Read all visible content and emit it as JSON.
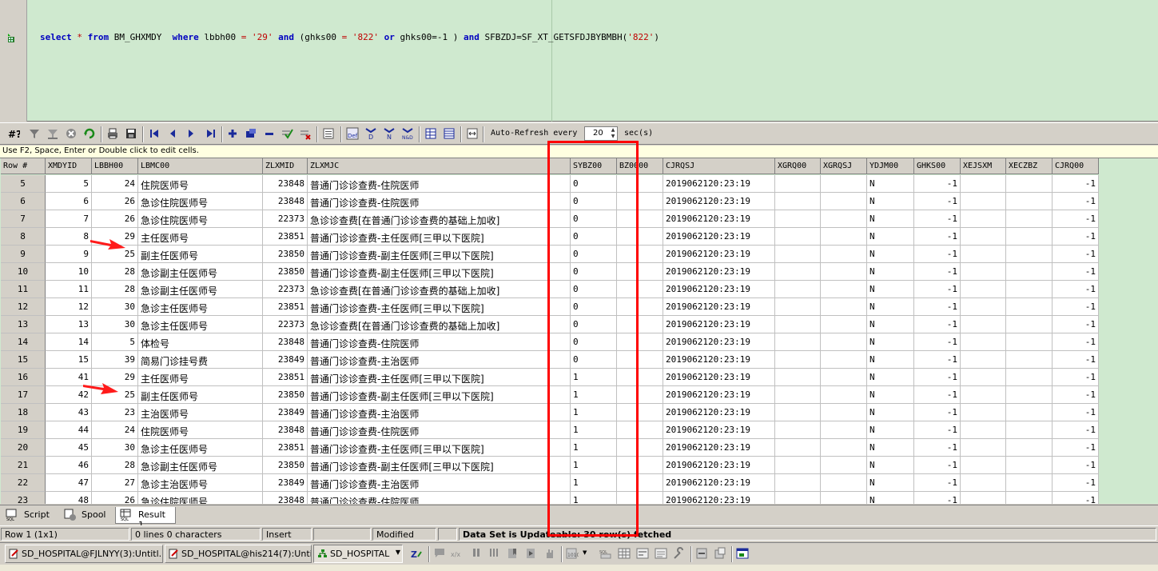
{
  "editor": {
    "top_fragment": "",
    "sql": {
      "kw_select": "select",
      "star": "*",
      "kw_from": "from",
      "table": "BM_GHXMDY",
      "kw_where": "where",
      "col1": "lbbh00",
      "eq1": "=",
      "val1": "'29'",
      "kw_and1": "and",
      "paren_open": "(ghks00",
      "eq2": "=",
      "val2": "'822'",
      "kw_or": "or",
      "col3": "ghks00=-1",
      "paren_close": ")",
      "kw_and2": "and",
      "col4": "SFBZDJ=SF_XT_GETSFDJBYBMBH(",
      "val4": "'822'",
      "close4": ")"
    }
  },
  "toolbar": {
    "auto_refresh_label": "Auto-Refresh every",
    "auto_refresh_value": "20",
    "auto_refresh_unit": "sec(s)",
    "icons": [
      "query-by-example-icon",
      "filter-icon",
      "clear-filter-icon",
      "cancel-icon",
      "refresh-icon",
      "print-icon",
      "save-icon",
      "first-record-icon",
      "previous-record-icon",
      "next-record-icon",
      "last-record-icon",
      "insert-record-icon",
      "duplicate-record-icon",
      "delete-record-icon",
      "post-changes-icon",
      "cancel-changes-icon",
      "single-record-view-icon",
      "def-icon",
      "d-icon",
      "n-icon",
      "n-and-d-icon",
      "grid-view-icon",
      "column-view-icon",
      "auto-width-icon"
    ]
  },
  "hint": "Use F2, Space, Enter or Double click to edit cells.",
  "grid": {
    "columns": [
      "Row #",
      "XMDYID",
      "LBBH00",
      "LBMC00",
      "ZLXMID",
      "ZLXMJC",
      "SYBZ00",
      "BZ0000",
      "CJRQSJ",
      "XGRQ00",
      "XGRQSJ",
      "YDJM00",
      "GHKS00",
      "XEJSXM",
      "XECZBZ",
      "CJRQ00"
    ],
    "rows": [
      [
        "5",
        "5",
        "24",
        "住院医师号",
        "23848",
        "普通门诊诊查费-住院医师",
        "0",
        "",
        "2019062120:23:19",
        "",
        "",
        "N",
        "-1",
        "",
        "",
        "-1"
      ],
      [
        "6",
        "6",
        "26",
        "急诊住院医师号",
        "23848",
        "普通门诊诊查费-住院医师",
        "0",
        "",
        "2019062120:23:19",
        "",
        "",
        "N",
        "-1",
        "",
        "",
        "-1"
      ],
      [
        "7",
        "7",
        "26",
        "急诊住院医师号",
        "22373",
        "急诊诊查费[在普通门诊诊查费的基础上加收]",
        "0",
        "",
        "2019062120:23:19",
        "",
        "",
        "N",
        "-1",
        "",
        "",
        "-1"
      ],
      [
        "8",
        "8",
        "29",
        "主任医师号",
        "23851",
        "普通门诊诊查费-主任医师[三甲以下医院]",
        "0",
        "",
        "2019062120:23:19",
        "",
        "",
        "N",
        "-1",
        "",
        "",
        "-1"
      ],
      [
        "9",
        "9",
        "25",
        "副主任医师号",
        "23850",
        "普通门诊诊查费-副主任医师[三甲以下医院]",
        "0",
        "",
        "2019062120:23:19",
        "",
        "",
        "N",
        "-1",
        "",
        "",
        "-1"
      ],
      [
        "10",
        "10",
        "28",
        "急诊副主任医师号",
        "23850",
        "普通门诊诊查费-副主任医师[三甲以下医院]",
        "0",
        "",
        "2019062120:23:19",
        "",
        "",
        "N",
        "-1",
        "",
        "",
        "-1"
      ],
      [
        "11",
        "11",
        "28",
        "急诊副主任医师号",
        "22373",
        "急诊诊查费[在普通门诊诊查费的基础上加收]",
        "0",
        "",
        "2019062120:23:19",
        "",
        "",
        "N",
        "-1",
        "",
        "",
        "-1"
      ],
      [
        "12",
        "12",
        "30",
        "急诊主任医师号",
        "23851",
        "普通门诊诊查费-主任医师[三甲以下医院]",
        "0",
        "",
        "2019062120:23:19",
        "",
        "",
        "N",
        "-1",
        "",
        "",
        "-1"
      ],
      [
        "13",
        "13",
        "30",
        "急诊主任医师号",
        "22373",
        "急诊诊查费[在普通门诊诊查费的基础上加收]",
        "0",
        "",
        "2019062120:23:19",
        "",
        "",
        "N",
        "-1",
        "",
        "",
        "-1"
      ],
      [
        "14",
        "14",
        "5",
        "体检号",
        "23848",
        "普通门诊诊查费-住院医师",
        "0",
        "",
        "2019062120:23:19",
        "",
        "",
        "N",
        "-1",
        "",
        "",
        "-1"
      ],
      [
        "15",
        "15",
        "39",
        "简易门诊挂号费",
        "23849",
        "普通门诊诊查费-主治医师",
        "0",
        "",
        "2019062120:23:19",
        "",
        "",
        "N",
        "-1",
        "",
        "",
        "-1"
      ],
      [
        "16",
        "41",
        "29",
        "主任医师号",
        "23851",
        "普通门诊诊查费-主任医师[三甲以下医院]",
        "1",
        "",
        "2019062120:23:19",
        "",
        "",
        "N",
        "-1",
        "",
        "",
        "-1"
      ],
      [
        "17",
        "42",
        "25",
        "副主任医师号",
        "23850",
        "普通门诊诊查费-副主任医师[三甲以下医院]",
        "1",
        "",
        "2019062120:23:19",
        "",
        "",
        "N",
        "-1",
        "",
        "",
        "-1"
      ],
      [
        "18",
        "43",
        "23",
        "主治医师号",
        "23849",
        "普通门诊诊查费-主治医师",
        "1",
        "",
        "2019062120:23:19",
        "",
        "",
        "N",
        "-1",
        "",
        "",
        "-1"
      ],
      [
        "19",
        "44",
        "24",
        "住院医师号",
        "23848",
        "普通门诊诊查费-住院医师",
        "1",
        "",
        "2019062120:23:19",
        "",
        "",
        "N",
        "-1",
        "",
        "",
        "-1"
      ],
      [
        "20",
        "45",
        "30",
        "急诊主任医师号",
        "23851",
        "普通门诊诊查费-主任医师[三甲以下医院]",
        "1",
        "",
        "2019062120:23:19",
        "",
        "",
        "N",
        "-1",
        "",
        "",
        "-1"
      ],
      [
        "21",
        "46",
        "28",
        "急诊副主任医师号",
        "23850",
        "普通门诊诊查费-副主任医师[三甲以下医院]",
        "1",
        "",
        "2019062120:23:19",
        "",
        "",
        "N",
        "-1",
        "",
        "",
        "-1"
      ],
      [
        "22",
        "47",
        "27",
        "急诊主治医师号",
        "23849",
        "普通门诊诊查费-主治医师",
        "1",
        "",
        "2019062120:23:19",
        "",
        "",
        "N",
        "-1",
        "",
        "",
        "-1"
      ],
      [
        "23",
        "48",
        "26",
        "急诊住院医师号",
        "23848",
        "普通门诊诊查费-住院医师",
        "1",
        "",
        "2019062120:23:19",
        "",
        "",
        "N",
        "-1",
        "",
        "",
        "-1"
      ]
    ]
  },
  "tabs": [
    "Script",
    "Spool",
    "Result 1"
  ],
  "status": {
    "position": "Row 1 (1x1)",
    "lines": "0 lines 0 characters",
    "mode": "Insert",
    "blank": "",
    "modified": "Modified",
    "blank2": "",
    "message": "Data Set is Updateable: 30 row(s) fetched"
  },
  "windows": [
    "SD_HOSPITAL@FJLNYY(3):Untitl..",
    "SD_HOSPITAL@his214(7):Untitl..",
    "SD_HOSPITAL"
  ],
  "colors": {
    "editor_bg": "#cfe9cf",
    "keyword": "#0000c0",
    "string": "#c00000",
    "annotation": "#ff0000"
  }
}
